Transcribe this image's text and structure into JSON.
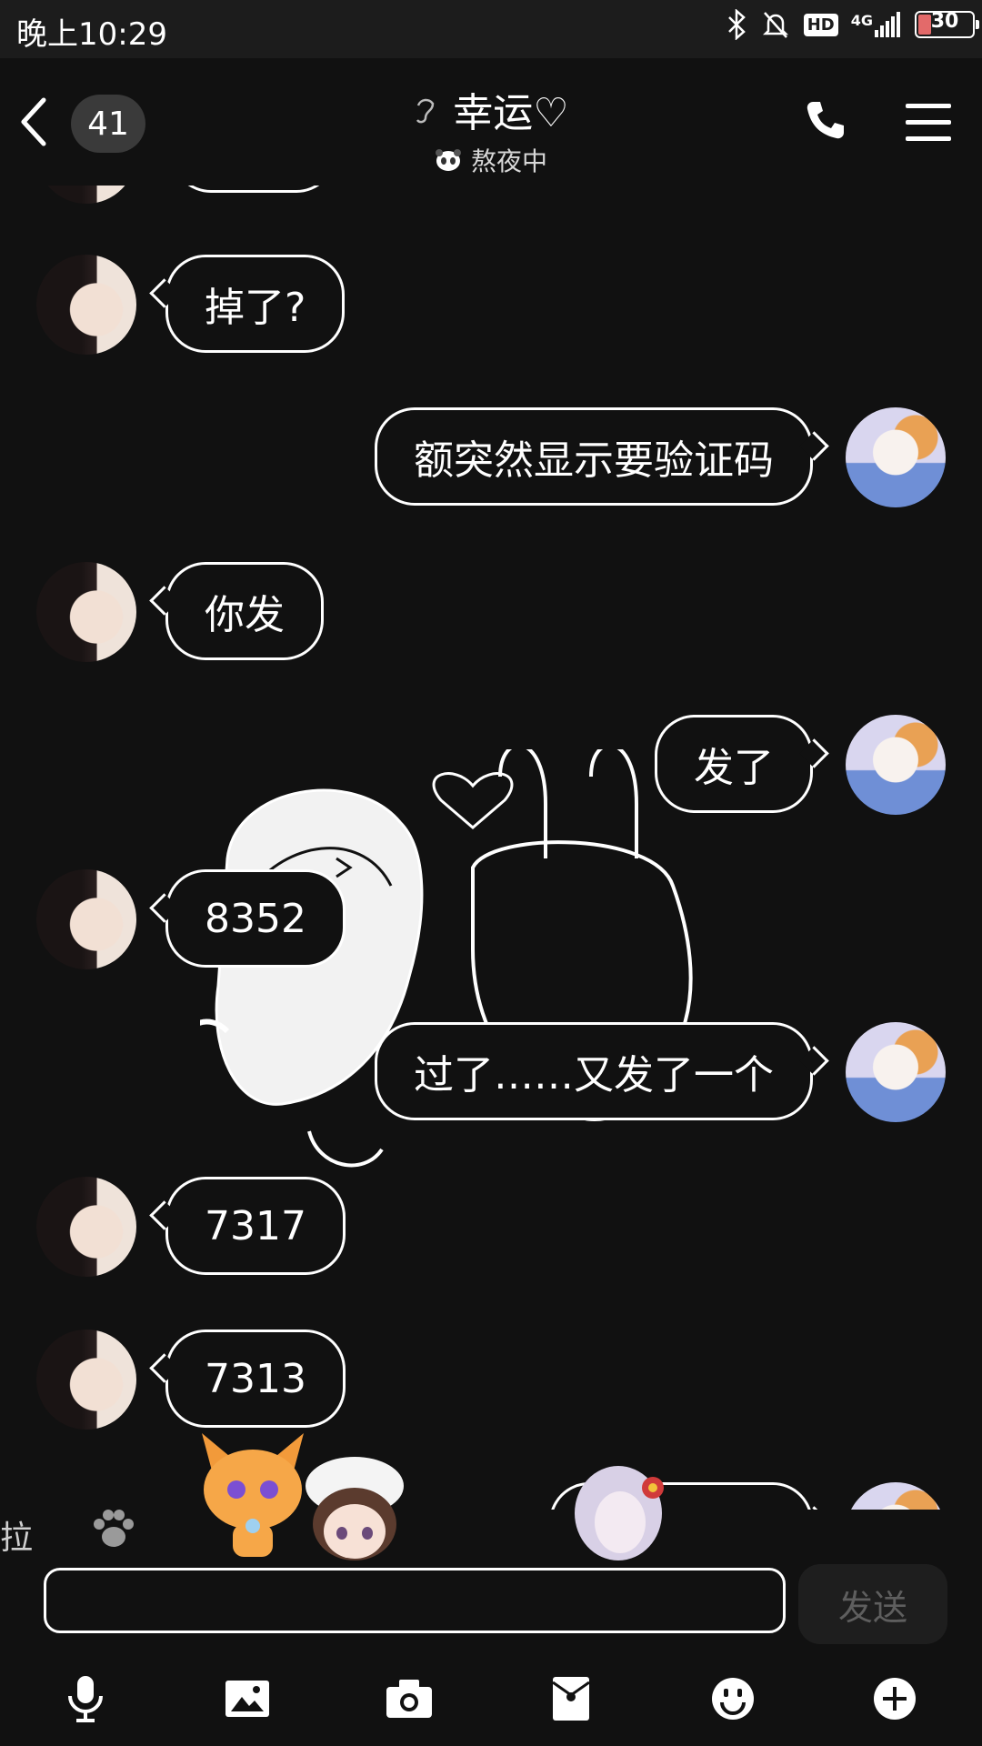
{
  "status_bar": {
    "time": "晚上10:29",
    "hd": "HD",
    "network": "4G",
    "battery": "30"
  },
  "header": {
    "unread_count": "41",
    "title": "幸运♡",
    "status": "熬夜中"
  },
  "messages": [
    {
      "side": "left",
      "text": "掉了?"
    },
    {
      "side": "right",
      "text": "额突然显示要验证码"
    },
    {
      "side": "left",
      "text": "你发"
    },
    {
      "side": "right",
      "text": "发了"
    },
    {
      "side": "left",
      "text": "8352"
    },
    {
      "side": "right",
      "text": "过了……又发了一个"
    },
    {
      "side": "left",
      "text": "7317"
    },
    {
      "side": "left",
      "text": "7313"
    }
  ],
  "sticker_bar": {
    "label": "拉拉"
  },
  "input": {
    "value": "",
    "send_label": "发送"
  },
  "colors": {
    "background": "#111111",
    "bubble_border": "#ffffff",
    "send_disabled_text": "#5e5e5e"
  },
  "toolbar_icons": [
    "mic-icon",
    "image-icon",
    "camera-icon",
    "red-packet-icon",
    "emoji-icon",
    "plus-icon"
  ]
}
